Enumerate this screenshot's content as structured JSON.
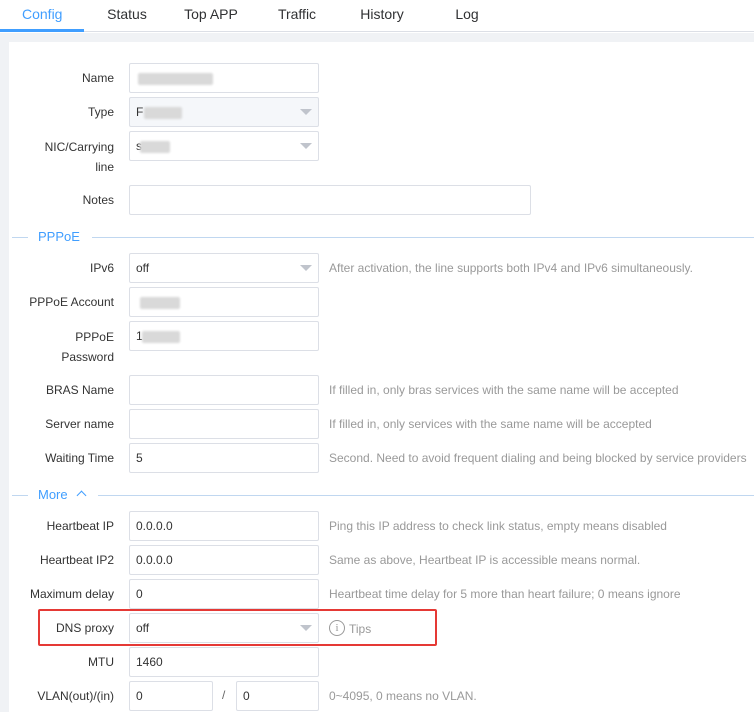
{
  "tabs": [
    {
      "label": "Config",
      "active": true
    },
    {
      "label": "Status"
    },
    {
      "label": "Top APP"
    },
    {
      "label": "Traffic"
    },
    {
      "label": "History"
    },
    {
      "label": "Log"
    }
  ],
  "form": {
    "name": {
      "label": "Name",
      "value": ""
    },
    "type": {
      "label": "Type",
      "value": "F"
    },
    "nic": {
      "label": "NIC/Carrying line",
      "value": "s"
    },
    "notes": {
      "label": "Notes",
      "value": ""
    }
  },
  "pppoe": {
    "section_title": "PPPoE",
    "ipv6": {
      "label": "IPv6",
      "value": "off",
      "hint": "After activation, the line supports both IPv4 and IPv6 simultaneously."
    },
    "account": {
      "label": "PPPoE Account",
      "value": ""
    },
    "password": {
      "label": "PPPoE Password",
      "value": "1"
    },
    "bras": {
      "label": "BRAS Name",
      "value": "",
      "hint": "If filled in, only bras services with the same name will be accepted"
    },
    "server": {
      "label": "Server name",
      "value": "",
      "hint": "If filled in, only services with the same name will be accepted"
    },
    "waiting": {
      "label": "Waiting Time",
      "value": "5",
      "hint": "Second. Need to avoid frequent dialing and being blocked by service providers"
    }
  },
  "more": {
    "section_title": "More",
    "heartbeat_ip": {
      "label": "Heartbeat IP",
      "value": "0.0.0.0",
      "hint": "Ping this IP address to check link status, empty means disabled"
    },
    "heartbeat_ip2": {
      "label": "Heartbeat IP2",
      "value": "0.0.0.0",
      "hint": "Same as above, Heartbeat IP is accessible means normal."
    },
    "max_delay": {
      "label": "Maximum delay",
      "value": "0",
      "hint": "Heartbeat time delay for 5 more than heart failure; 0 means ignore"
    },
    "dns_proxy": {
      "label": "DNS proxy",
      "value": "off",
      "tips": "Tips"
    },
    "mtu": {
      "label": "MTU",
      "value": "1460"
    },
    "vlan": {
      "label": "VLAN(out)/(in)",
      "out": "0",
      "in": "0",
      "separator": "/",
      "hint": "0~4095, 0 means no VLAN."
    }
  },
  "colors": {
    "accent": "#409eff",
    "highlight": "#e53935"
  }
}
